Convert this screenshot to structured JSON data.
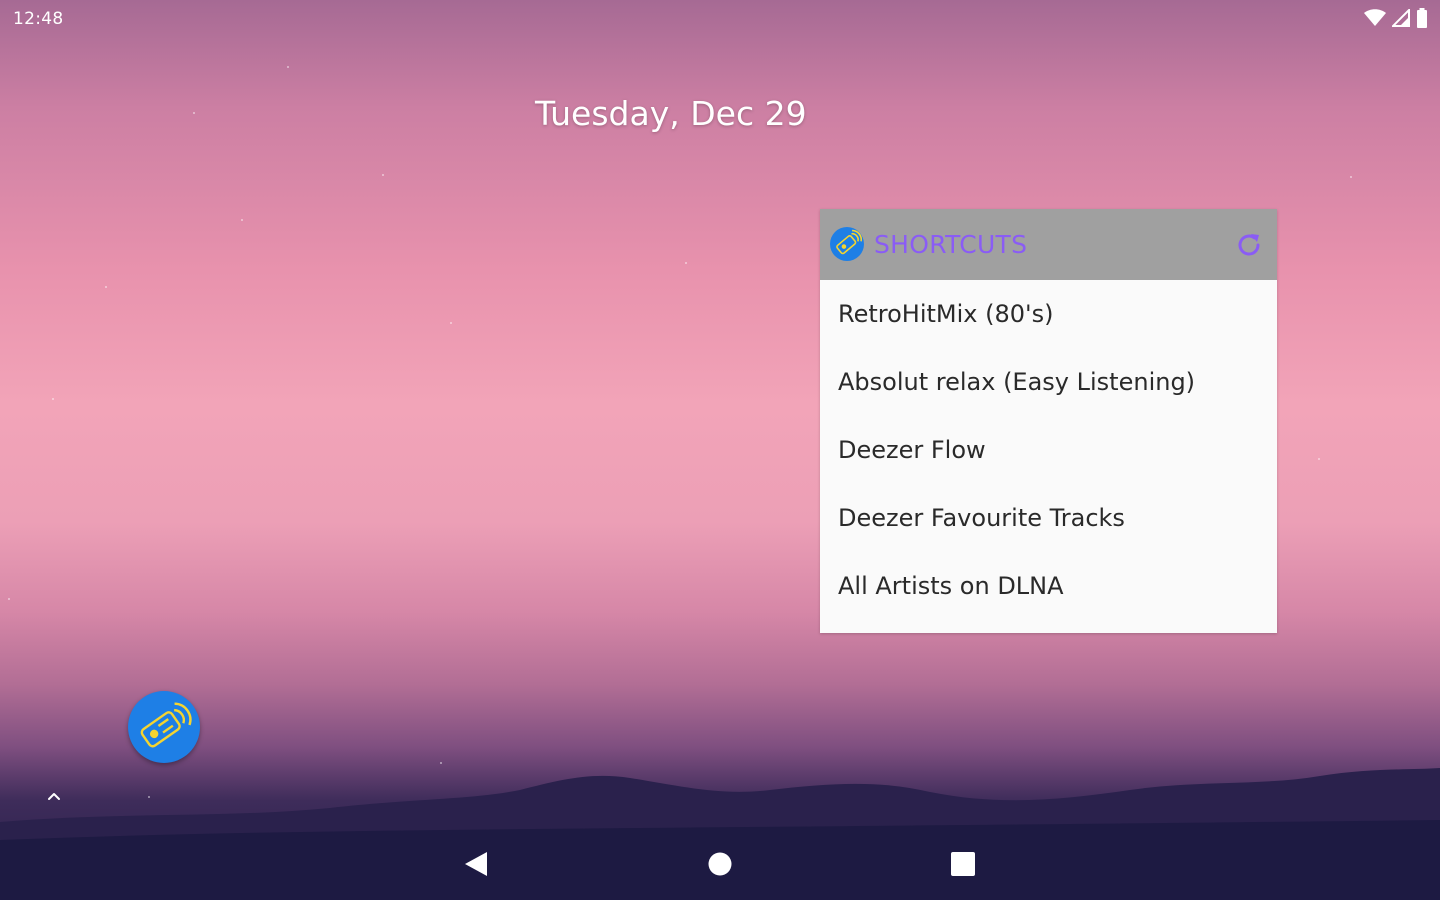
{
  "status_bar": {
    "time": "12:48",
    "icons": [
      "wifi-icon",
      "cell-signal-icon",
      "battery-icon"
    ]
  },
  "home": {
    "date": "Tuesday, Dec 29"
  },
  "widget": {
    "title": "SHORTCUTS",
    "app_icon": "remote-app-icon",
    "refresh_icon": "refresh-icon",
    "items": [
      {
        "label": "RetroHitMix (80's)"
      },
      {
        "label": "Absolut relax (Easy Listening)"
      },
      {
        "label": "Deezer Flow"
      },
      {
        "label": "Deezer Favourite Tracks"
      },
      {
        "label": "All Artists on DLNA"
      }
    ]
  },
  "dock": {
    "app_icon": "remote-app-icon",
    "drawer_handle_icon": "chevron-up-icon"
  },
  "nav_bar": {
    "buttons": [
      "back-icon",
      "home-icon",
      "recents-icon"
    ]
  },
  "colors": {
    "accent": "#8a5cf5",
    "widget_header": "#a0a0a0",
    "fab": "#1e7fe6",
    "remote_yellow": "#f5d430"
  }
}
